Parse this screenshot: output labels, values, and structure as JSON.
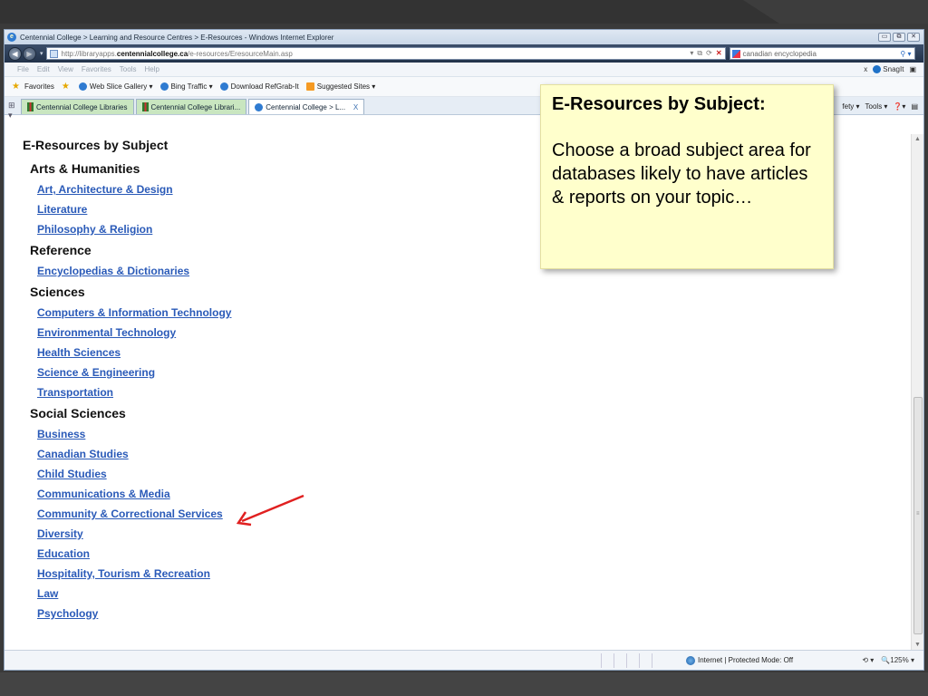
{
  "window": {
    "title": "Centennial College > Learning and Resource Centres > E-Resources - Windows Internet Explorer",
    "controls": [
      "▭",
      "⧉",
      "✕"
    ]
  },
  "address": {
    "url_prefix": "http://libraryapps.",
    "url_domain": "centennialcollege.ca",
    "url_path": "/e-resources/EresourceMain.asp",
    "search_value": "canadian encyclopedia"
  },
  "menu": {
    "items": [
      "File",
      "Edit",
      "View",
      "Favorites",
      "Tools",
      "Help"
    ],
    "snagit": "SnagIt"
  },
  "favorites": {
    "label": "Favorites",
    "items": [
      "Web Slice Gallery ▾",
      "Bing Traffic ▾",
      "Download RefGrab-It",
      "Suggested Sites ▾"
    ]
  },
  "tabs": {
    "items": [
      "Centennial College Libraries",
      "Centennial College Librari...",
      "Centennial College > L..."
    ],
    "close": "X",
    "right_safety": "fety ▾",
    "right_tools": "Tools ▾"
  },
  "page": {
    "heading": "E-Resources by Subject",
    "categories": [
      {
        "name": "Arts & Humanities",
        "links": [
          "Art, Architecture & Design",
          "Literature",
          "Philosophy & Religion"
        ]
      },
      {
        "name": "Reference",
        "links": [
          "Encyclopedias & Dictionaries"
        ]
      },
      {
        "name": "Sciences",
        "links": [
          "Computers & Information Technology",
          "Environmental Technology",
          "Health Sciences",
          "Science & Engineering",
          "Transportation"
        ]
      },
      {
        "name": "Social Sciences",
        "links": [
          "Business",
          "Canadian Studies",
          "Child Studies",
          "Communications & Media",
          "Community & Correctional Services",
          "Diversity",
          "Education",
          "Hospitality, Tourism & Recreation",
          "Law",
          "Psychology"
        ]
      }
    ]
  },
  "status": {
    "zone": "Internet | Protected Mode: Off",
    "zoom": "125%"
  },
  "callout": {
    "title": "E-Resources by Subject:",
    "body": "Choose a broad subject area for databases likely to have articles & reports on your topic…"
  },
  "colors": {
    "link": "#2a5ab8",
    "callout_bg": "#ffffcc",
    "arrow": "#e02020"
  }
}
